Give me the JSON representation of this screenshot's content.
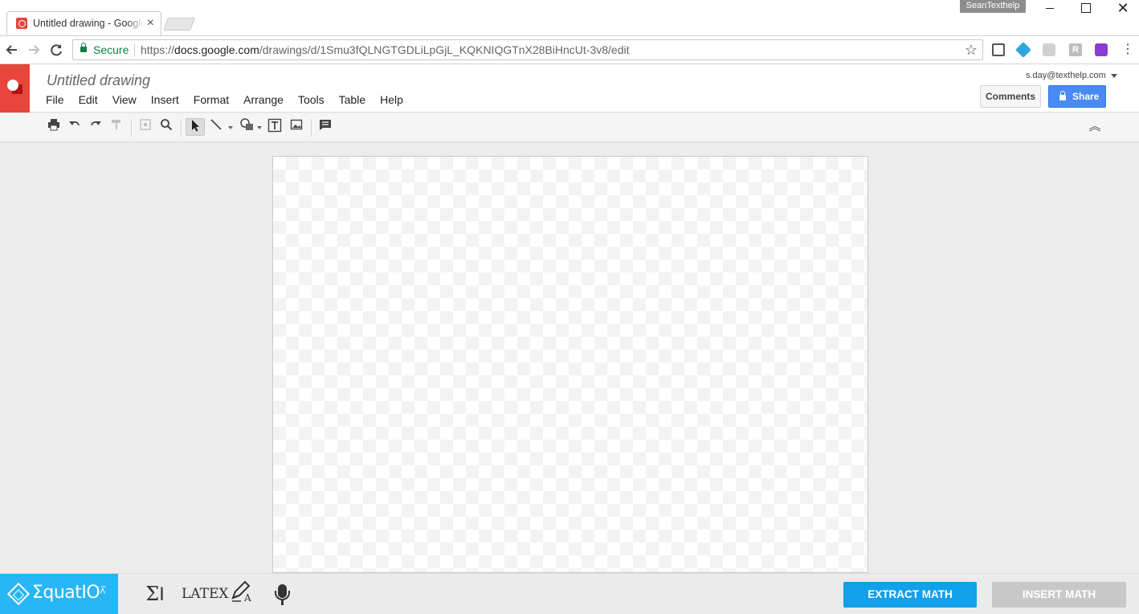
{
  "browser": {
    "tab_title": "Untitled drawing - Google Drawings",
    "tab_close_glyph": "×",
    "profile_name": "SeanTexthelp",
    "window_close_glyph": "✕",
    "secure_label": "Secure",
    "url_scheme": "https://",
    "url_host": "docs.google.com",
    "url_path": "/drawings/d/1Smu3fQLNGTGDLiLpGjL_KQKNIQGTnX28BiHncUt-3v8/edit",
    "star_glyph": "☆",
    "menu_glyph": "⋮",
    "extension_r_label": "R",
    "nav_icons": [
      "back-arrow",
      "forward-arrow",
      "reload"
    ]
  },
  "app": {
    "doc_title": "Untitled drawing",
    "account_email": "s.day@texthelp.com",
    "menu": [
      "File",
      "Edit",
      "View",
      "Insert",
      "Format",
      "Arrange",
      "Tools",
      "Table",
      "Help"
    ],
    "comments_label": "Comments",
    "share_label": "Share",
    "brand_color": "#e8453c",
    "share_color": "#4a8af4"
  },
  "drawing_toolbar": {
    "tools": [
      "print",
      "undo",
      "redo",
      "paint-format",
      "zoom-fit",
      "zoom",
      "select",
      "line",
      "shape",
      "text-box",
      "image",
      "comment"
    ],
    "selected_tool": "select",
    "collapse_glyph": "︽"
  },
  "equatio": {
    "brand_name": "ΣquatIO",
    "tm_mark": "™",
    "caret_glyph": "˄",
    "tools": [
      "math-input",
      "latex",
      "handwriting",
      "speech"
    ],
    "sigma_glyph": "Σ",
    "latex_label": "LATEX",
    "extract_label": "EXTRACT MATH",
    "insert_label": "INSERT MATH",
    "accent_color": "#29b6f6"
  }
}
